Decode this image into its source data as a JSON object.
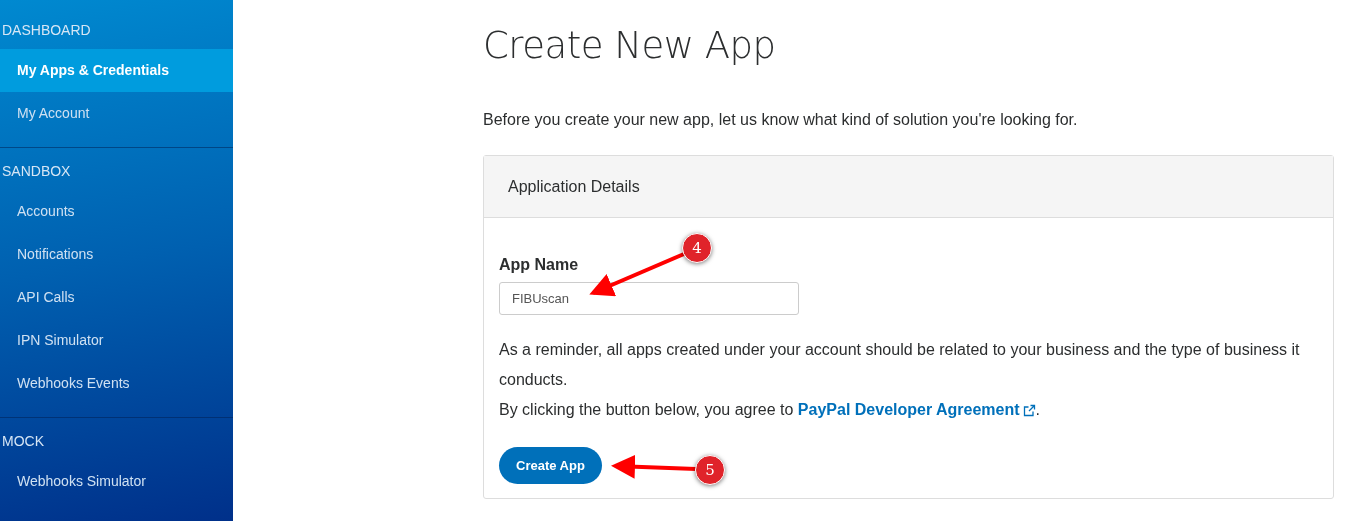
{
  "sidebar": {
    "sections": [
      {
        "heading": "DASHBOARD",
        "items": [
          {
            "label": "My Apps & Credentials",
            "selected": true
          },
          {
            "label": "My Account",
            "selected": false
          }
        ]
      },
      {
        "heading": "SANDBOX",
        "items": [
          {
            "label": "Accounts",
            "selected": false
          },
          {
            "label": "Notifications",
            "selected": false
          },
          {
            "label": "API Calls",
            "selected": false
          },
          {
            "label": "IPN Simulator",
            "selected": false
          },
          {
            "label": "Webhooks Events",
            "selected": false
          }
        ]
      },
      {
        "heading": "MOCK",
        "items": [
          {
            "label": "Webhooks Simulator",
            "selected": false
          }
        ]
      }
    ]
  },
  "page": {
    "title": "Create New App",
    "intro": "Before you create your new app, let us know what kind of solution you're looking for.",
    "card": {
      "title": "Application Details",
      "field": {
        "label": "App Name",
        "value": "FIBUscan"
      },
      "reminder": "As a reminder, all apps created under your account should be related to your business and the type of business it conducts.",
      "agreement": "By clicking the button below, you agree to",
      "link": "PayPal Developer Agreement",
      "after_link": ".",
      "button": "Create App"
    }
  },
  "annotations": [
    {
      "label": "4"
    },
    {
      "label": "5"
    }
  ]
}
